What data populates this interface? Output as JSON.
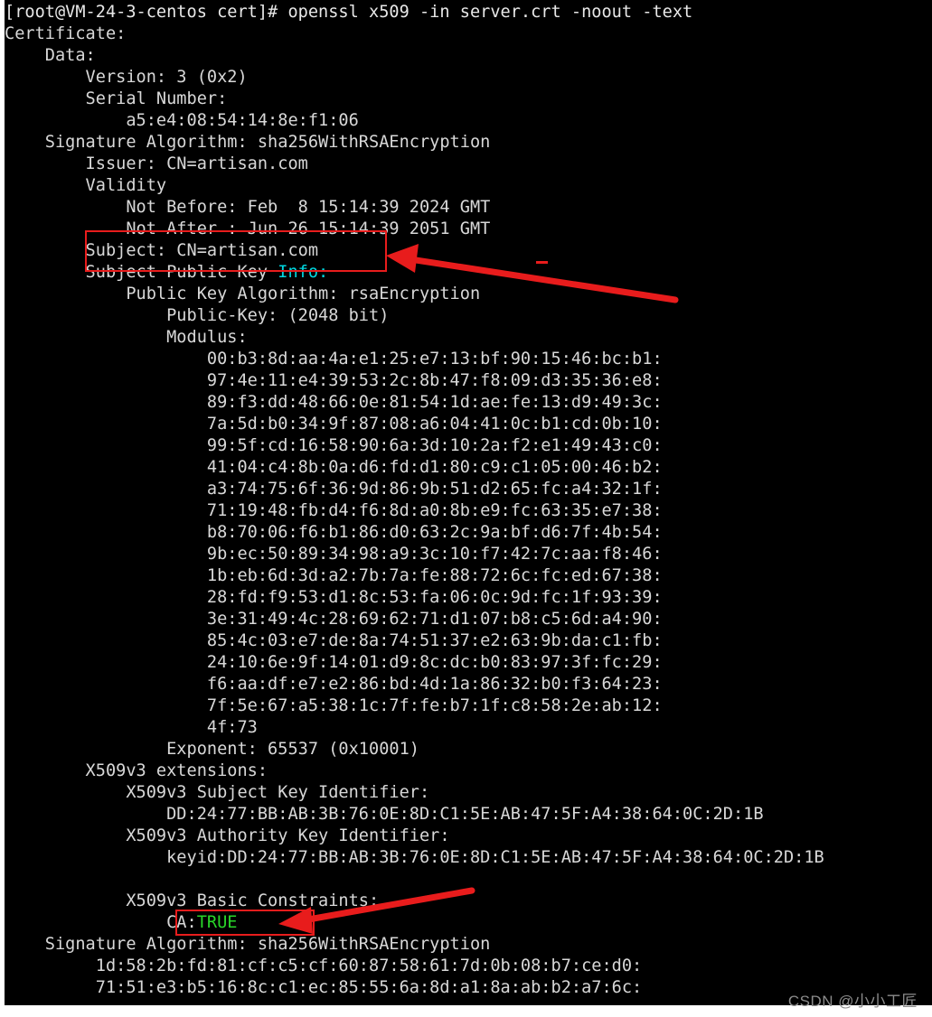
{
  "terminal": {
    "background_color": "#000000",
    "foreground_color": "#d8d8d8",
    "cyan_color": "#00d7e0",
    "green_color": "#29d629",
    "annotation_color": "#e81c1c",
    "prompt": "[root@VM-24-3-centos cert]# openssl x509 -in server.crt -noout -text",
    "lines": [
      "Certificate:",
      "    Data:",
      "        Version: 3 (0x2)",
      "        Serial Number:",
      "            a5:e4:08:54:14:8e:f1:06",
      "    Signature Algorithm: sha256WithRSAEncryption",
      "        Issuer: CN=artisan.com",
      "        Validity",
      "            Not Before: Feb  8 15:14:39 2024 GMT",
      "            Not After : Jun 26 15:14:39 2051 GMT",
      "        Subject: CN=artisan.com",
      "        Subject Public Key Info:",
      "            Public Key Algorithm: rsaEncryption",
      "                Public-Key: (2048 bit)",
      "                Modulus:",
      "                    00:b3:8d:aa:4a:e1:25:e7:13:bf:90:15:46:bc:b1:",
      "                    97:4e:11:e4:39:53:2c:8b:47:f8:09:d3:35:36:e8:",
      "                    89:f3:dd:48:66:0e:81:54:1d:ae:fe:13:d9:49:3c:",
      "                    7a:5d:b0:34:9f:87:08:a6:04:41:0c:b1:cd:0b:10:",
      "                    99:5f:cd:16:58:90:6a:3d:10:2a:f2:e1:49:43:c0:",
      "                    41:04:c4:8b:0a:d6:fd:d1:80:c9:c1:05:00:46:b2:",
      "                    a3:74:75:6f:36:9d:86:9b:51:d2:65:fc:a4:32:1f:",
      "                    71:19:48:fb:d4:f6:8d:a0:8b:e9:fc:63:35:e7:38:",
      "                    b8:70:06:f6:b1:86:d0:63:2c:9a:bf:d6:7f:4b:54:",
      "                    9b:ec:50:89:34:98:a9:3c:10:f7:42:7c:aa:f8:46:",
      "                    1b:eb:6d:3d:a2:7b:7a:fe:88:72:6c:fc:ed:67:38:",
      "                    28:fd:f9:53:d1:8c:53:fa:06:0c:9d:fc:1f:93:39:",
      "                    3e:31:49:4c:28:69:62:71:d1:07:b8:c5:6d:a4:90:",
      "                    85:4c:03:e7:de:8a:74:51:37:e2:63:9b:da:c1:fb:",
      "                    24:10:6e:9f:14:01:d9:8c:dc:b0:83:97:3f:fc:29:",
      "                    f6:aa:df:e7:e2:86:bd:4d:1a:86:32:b0:f3:64:23:",
      "                    7f:5e:67:a5:38:1c:7f:fe:b7:1f:c8:58:2e:ab:12:",
      "                    4f:73",
      "                Exponent: 65537 (0x10001)",
      "        X509v3 extensions:",
      "            X509v3 Subject Key Identifier:",
      "                DD:24:77:BB:AB:3B:76:0E:8D:C1:5E:AB:47:5F:A4:38:64:0C:2D:1B",
      "            X509v3 Authority Key Identifier:",
      "                keyid:DD:24:77:BB:AB:3B:76:0E:8D:C1:5E:AB:47:5F:A4:38:64:0C:2D:1B",
      "",
      "            X509v3 Basic Constraints:",
      "                CA:TRUE",
      "    Signature Algorithm: sha256WithRSAEncryption",
      "         1d:58:2b:fd:81:cf:c5:cf:60:87:58:61:7d:0b:08:b7:ce:d0:",
      "         71:51:e3:b5:16:8c:c1:ec:85:55:6a:8d:a1:8a:ab:b2:a7:6c:"
    ],
    "colored_segments": {
      "subject_public_key_info_prefix": "        Subject Public Key ",
      "subject_public_key_info_cyan": "Info:",
      "ca_prefix": "                CA:",
      "ca_value_green": "TRUE"
    }
  },
  "annotations": {
    "box_subject": {
      "label": "highlight-box-subject",
      "target_text": "Subject: CN=artisan.com"
    },
    "box_ca_true": {
      "label": "highlight-box-ca-true",
      "target_text": "CA:TRUE"
    },
    "arrow_to_subject": {
      "label": "arrow-pointing-to-subject"
    },
    "arrow_to_ca_true": {
      "label": "arrow-pointing-to-ca-true"
    }
  },
  "bottom_ghost_line": {
    "text": "                                                       ",
    "link_fragment": ""
  },
  "watermark": {
    "text": "CSDN @小小工匠"
  }
}
